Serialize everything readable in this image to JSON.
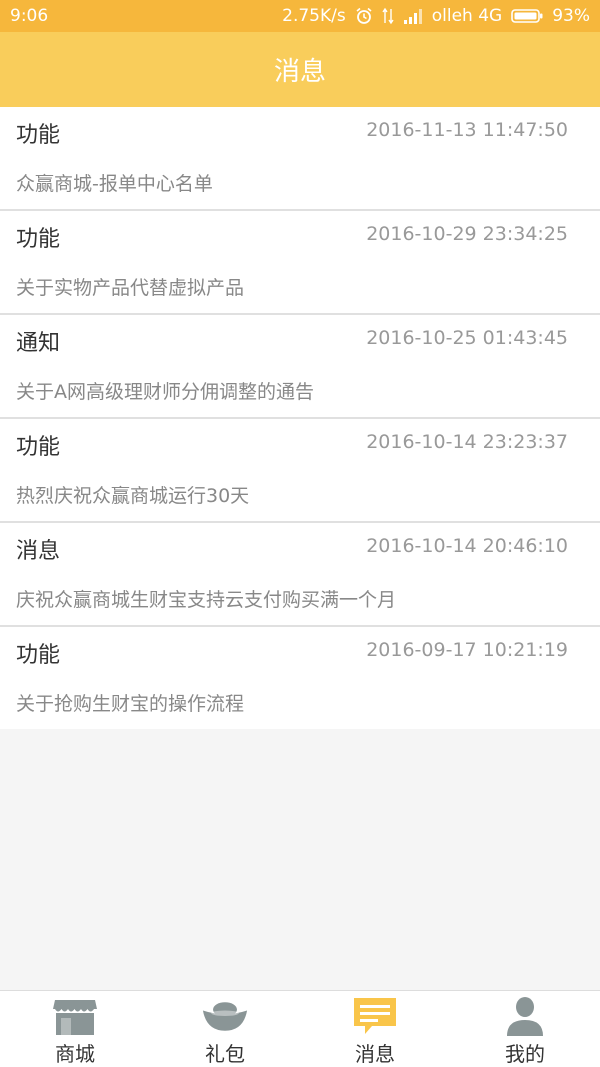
{
  "status_bar": {
    "time": "9:06",
    "network_speed": "2.75K/s",
    "carrier": "olleh 4G",
    "battery": "93%"
  },
  "header": {
    "title": "消息"
  },
  "messages": [
    {
      "type": "功能",
      "time": "2016-11-13 11:47:50",
      "title": "众赢商城-报单中心名单"
    },
    {
      "type": "功能",
      "time": "2016-10-29 23:34:25",
      "title": "关于实物产品代替虚拟产品"
    },
    {
      "type": "通知",
      "time": "2016-10-25 01:43:45",
      "title": "关于A网高级理财师分佣调整的通告"
    },
    {
      "type": "功能",
      "time": "2016-10-14 23:23:37",
      "title": "热烈庆祝众赢商城运行30天"
    },
    {
      "type": "消息",
      "time": "2016-10-14 20:46:10",
      "title": "庆祝众赢商城生财宝支持云支付购买满一个月"
    },
    {
      "type": "功能",
      "time": "2016-09-17 10:21:19",
      "title": "关于抢购生财宝的操作流程"
    }
  ],
  "bottom_nav": {
    "active_color": "#f9c54a",
    "inactive_color": "#8a9596",
    "items": [
      {
        "label": "商城",
        "icon": "store-icon",
        "active": false
      },
      {
        "label": "礼包",
        "icon": "gift-icon",
        "active": false
      },
      {
        "label": "消息",
        "icon": "message-icon",
        "active": true
      },
      {
        "label": "我的",
        "icon": "user-icon",
        "active": false
      }
    ]
  }
}
